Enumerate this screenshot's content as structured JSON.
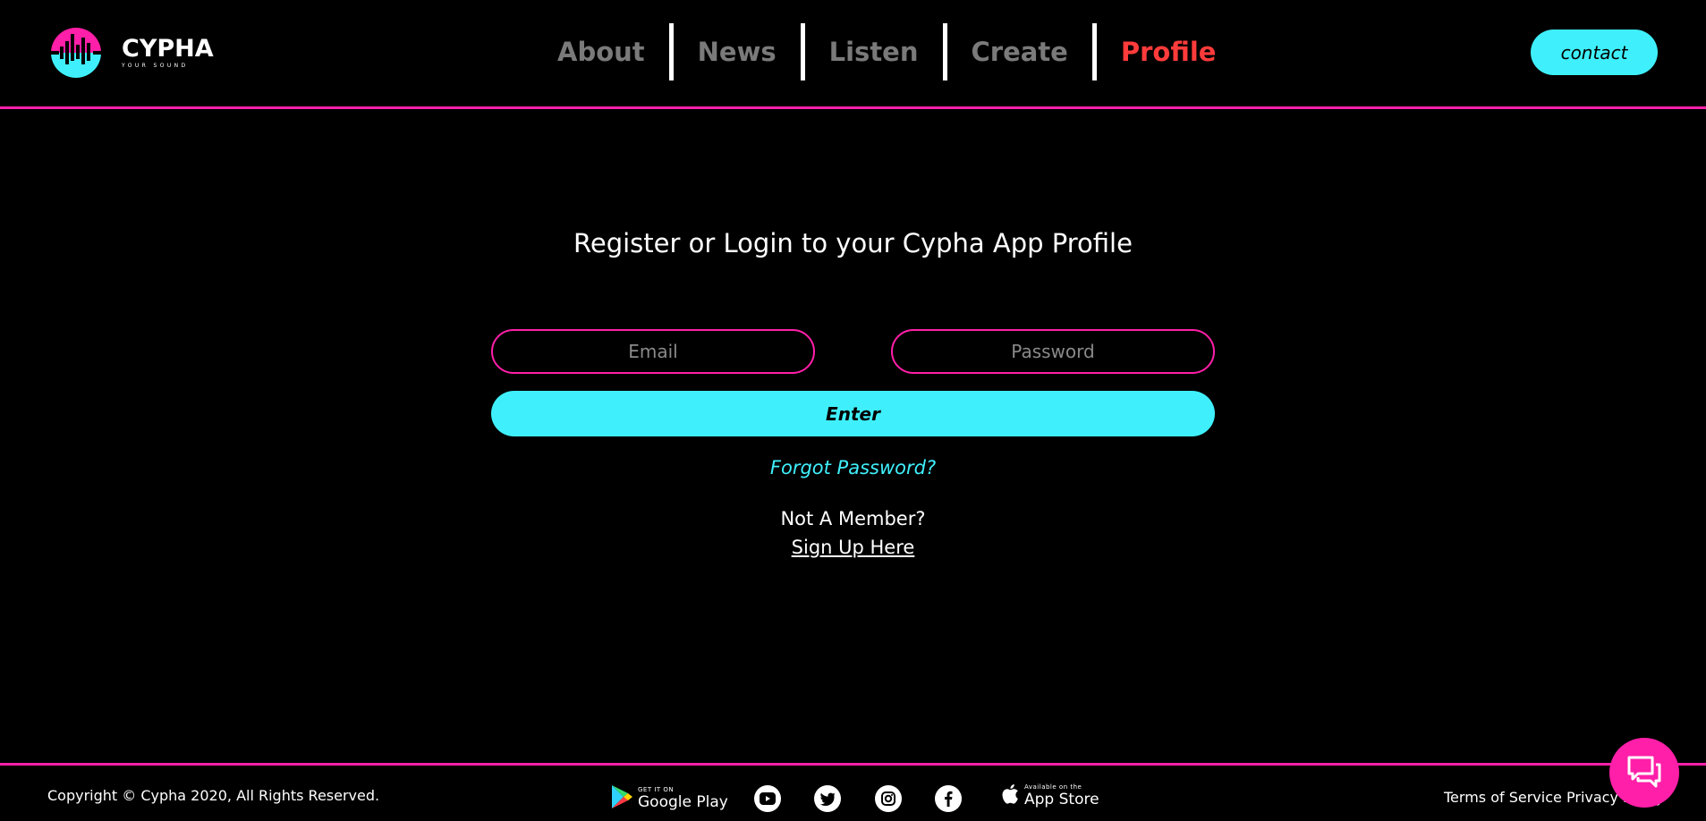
{
  "brand": {
    "name": "CYPHA",
    "tagline": "YOUR SOUND",
    "colors": {
      "pink": "#ff1fa8",
      "cyan": "#3ff0fc",
      "active": "#ff3b3b",
      "muted": "#7a7a7a"
    }
  },
  "nav": {
    "items": [
      {
        "label": "About",
        "active": false
      },
      {
        "label": "News",
        "active": false
      },
      {
        "label": "Listen",
        "active": false
      },
      {
        "label": "Create",
        "active": false
      },
      {
        "label": "Profile",
        "active": true
      }
    ],
    "contact_label": "contact"
  },
  "login": {
    "heading": "Register or Login to your Cypha App Profile",
    "email_placeholder": "Email",
    "password_placeholder": "Password",
    "enter_label": "Enter",
    "forgot_label": "Forgot Password?",
    "not_member": "Not A Member?",
    "signup_label": "Sign Up Here"
  },
  "footer": {
    "copyright": "Copyright © Cypha 2020, All Rights Reserved.",
    "google_small": "GET IT ON",
    "google_big": "Google Play",
    "apple_small": "Available on the",
    "apple_big": "App Store",
    "social": [
      "youtube-icon",
      "twitter-icon",
      "instagram-icon",
      "facebook-icon"
    ],
    "terms_label": "Terms of Service",
    "privacy_label": "Privacy Policy"
  },
  "chat": {
    "icon": "chat-icon"
  }
}
